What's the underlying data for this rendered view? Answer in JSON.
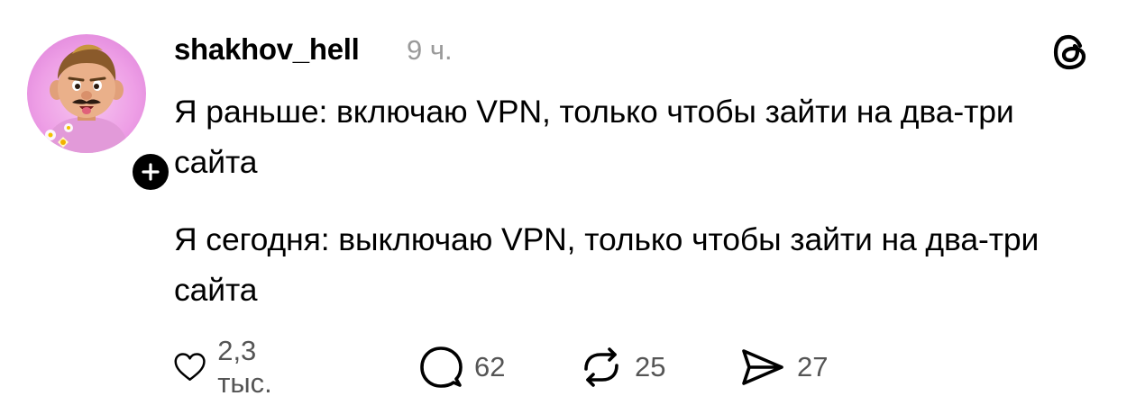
{
  "post": {
    "username": "shakhov_hell",
    "time": "9 ч.",
    "paragraphs": [
      "Я раньше: включаю VPN, только чтобы зайти на два-три сайта",
      "Я сегодня: выключаю VPN, только чтобы зайти на два-три сайта"
    ]
  },
  "actions": {
    "likes": "2,3 тыс.",
    "replies": "62",
    "reposts": "25",
    "shares": "27"
  },
  "icons": {
    "like": "heart-icon",
    "reply": "comment-bubble-icon",
    "repost": "repost-icon",
    "share": "send-icon",
    "follow": "plus-icon",
    "brand": "threads-logo-icon"
  }
}
